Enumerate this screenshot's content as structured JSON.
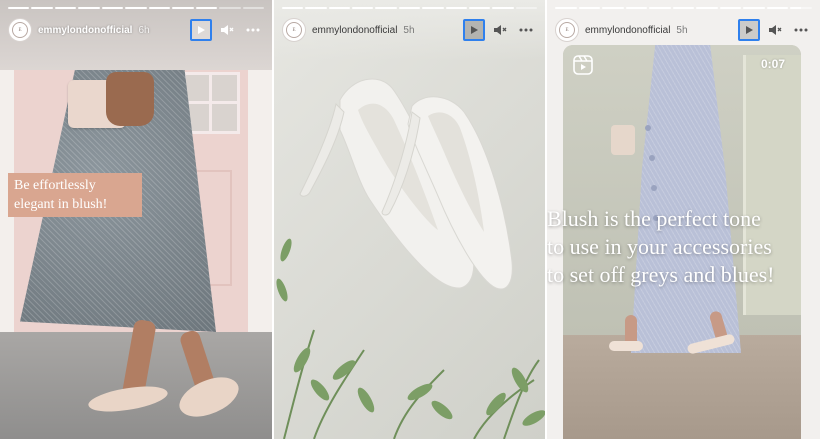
{
  "stories": [
    {
      "account": "emmylondonofficial",
      "time": "6h",
      "caption_lines": [
        "Be effortlessly",
        "elegant in blush!"
      ],
      "progress_segments": [
        1,
        1,
        1,
        1,
        1,
        1,
        1,
        1,
        1,
        0,
        0
      ]
    },
    {
      "account": "emmylondonofficial",
      "time": "5h",
      "progress_segments": [
        1,
        1,
        1,
        1,
        1,
        1,
        1,
        1,
        1,
        1,
        0
      ]
    },
    {
      "account": "emmylondonofficial",
      "time": "5h",
      "video_duration": "0:07",
      "caption_lines": [
        "Blush is the perfect tone",
        "to use in your accessories",
        "to set off greys and blues!"
      ],
      "progress_segments": [
        1,
        1,
        1,
        1,
        1,
        1,
        1,
        1,
        1,
        1,
        0.5
      ]
    }
  ],
  "icons": {
    "play": "play-icon",
    "sound": "speaker-icon",
    "muted": "speaker-muted-icon",
    "more": "more-icon",
    "reel": "reel-icon",
    "avatar": "brand-logo-avatar"
  },
  "colors": {
    "play_highlight": "#2f80ed",
    "caption_box": "#d9a690"
  }
}
